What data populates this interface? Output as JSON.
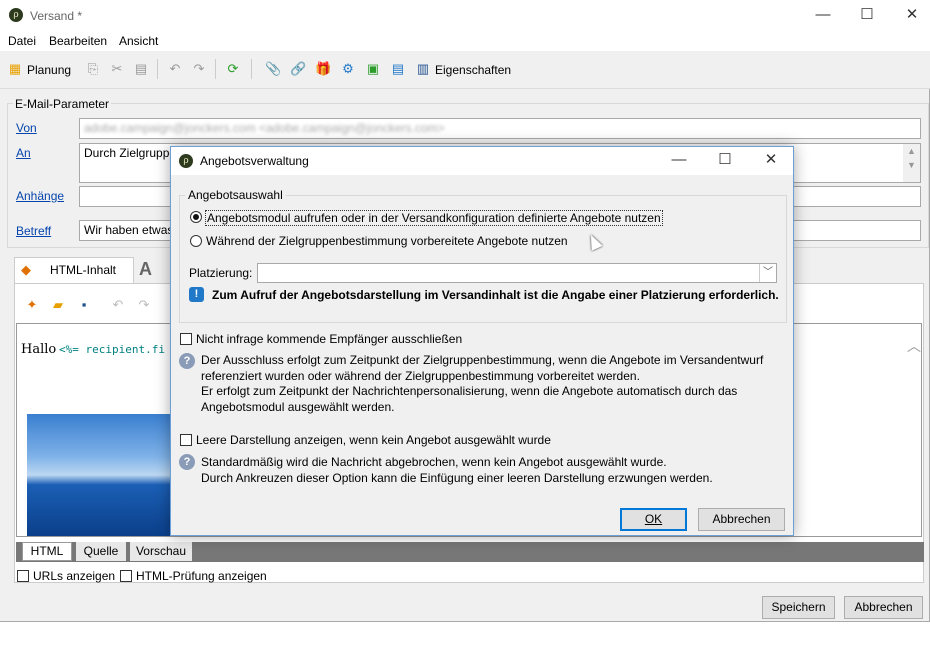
{
  "window": {
    "title": "Versand *"
  },
  "menu": [
    "Datei",
    "Bearbeiten",
    "Ansicht"
  ],
  "toolbar": {
    "planning": "Planung",
    "properties": "Eigenschaften"
  },
  "params": {
    "legend": "E-Mail-Parameter",
    "from_label": "Von",
    "from_value": "adobe.campaign@jonckers.com <adobe.campaign@jonckers.com>",
    "to_label": "An",
    "to_value": "Durch Zielgruppe",
    "attach_label": "Anhänge",
    "subject_label": "Betreff",
    "subject_value": "Wir haben etwas"
  },
  "editor": {
    "tab_html": "HTML-Inhalt",
    "tab_text": "A",
    "hello": "Hallo",
    "code": "<%= recipient.fi"
  },
  "bottom_tabs": [
    "HTML",
    "Quelle",
    "Vorschau"
  ],
  "bottom": {
    "urls": "URLs anzeigen",
    "htmlcheck": "HTML-Prüfung anzeigen",
    "save": "Speichern",
    "cancel": "Abbrechen"
  },
  "dialog": {
    "title": "Angebotsverwaltung",
    "group": "Angebotsauswahl",
    "radio1": "Angebotsmodul aufrufen oder in der Versandkonfiguration definierte Angebote nutzen",
    "radio2": "Während der Zielgruppenbestimmung vorbereitete Angebote nutzen",
    "placement_label": "Platzierung:",
    "placement_value": "",
    "warning": "Zum Aufruf der Angebotsdarstellung im Versandinhalt ist die Angabe einer Platzierung erforderlich.",
    "check1": "Nicht infrage kommende Empfänger ausschließen",
    "help1": [
      "Der Ausschluss erfolgt zum Zeitpunkt der Zielgruppenbestimmung, wenn die Angebote im Versandentwurf",
      "referenziert wurden oder während der Zielgruppenbestimmung vorbereitet werden.",
      "Er erfolgt zum Zeitpunkt der Nachrichtenpersonalisierung, wenn die Angebote automatisch durch das",
      "Angebotsmodul ausgewählt werden."
    ],
    "check2": "Leere Darstellung anzeigen, wenn kein Angebot ausgewählt wurde",
    "help2": [
      "Standardmäßig wird die Nachricht abgebrochen, wenn kein Angebot ausgewählt wurde.",
      "Durch Ankreuzen dieser Option kann die Einfügung einer leeren Darstellung erzwungen werden."
    ],
    "ok": "OK",
    "cancel": "Abbrechen"
  },
  "colors": {
    "accent": "#0645ad",
    "info": "#1f78c8",
    "dialog_border": "#6b9fd6"
  }
}
